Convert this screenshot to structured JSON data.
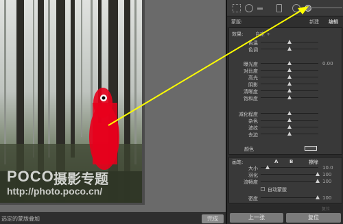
{
  "status_bar": {
    "text": "选定的蒙版叠加",
    "done_label": "完成"
  },
  "watermark": {
    "logo": "POCO",
    "logo_cn": "摄影专题",
    "url": "http://photo.poco.cn/"
  },
  "toolstrip": {
    "icons": [
      "crop-grid-icon",
      "spot-removal-icon",
      "red-eye-icon",
      "graduated-filter-icon",
      "radial-filter-icon",
      "adjustment-brush-icon"
    ]
  },
  "mask": {
    "label": "蒙版:",
    "new_label": "新建",
    "edit_label": "编辑"
  },
  "effects": {
    "label": "效果:",
    "value": "自定 ÷",
    "sliders": [
      {
        "label": "色温",
        "pos": 0.5
      },
      {
        "label": "色调",
        "pos": 0.5
      },
      {
        "label": "曝光度",
        "pos": 0.5,
        "value": "0.00"
      },
      {
        "label": "对比度",
        "pos": 0.5
      },
      {
        "label": "高光",
        "pos": 0.5
      },
      {
        "label": "阴影",
        "pos": 0.5
      },
      {
        "label": "清晰度",
        "pos": 0.5
      },
      {
        "label": "饱和度",
        "pos": 0.5
      },
      {
        "label": "减化程度",
        "pos": 0.5
      },
      {
        "label": "杂色",
        "pos": 0.5
      },
      {
        "label": "波纹",
        "pos": 0.5
      },
      {
        "label": "去边",
        "pos": 0.5
      }
    ],
    "color_label": "颜色"
  },
  "brush": {
    "label": "画笔:",
    "a_label": "A",
    "b_label": "B",
    "erase_label": "擦除",
    "sliders": [
      {
        "label": "大小",
        "pos": 0.12,
        "value": "10.0"
      },
      {
        "label": "羽化",
        "pos": 0.99,
        "value": "100"
      },
      {
        "label": "流畅度",
        "pos": 0.99,
        "value": "100"
      }
    ],
    "auto_mask_label": "自动蒙版",
    "density": {
      "label": "密度",
      "pos": 0.99,
      "value": "100"
    }
  },
  "footer": {
    "reset_small": "复位",
    "prev_label": "上一张",
    "reset_label": "复位"
  },
  "colors": {
    "mask_overlay": "#e8001c",
    "annotation_arrow": "#ffff00",
    "panel_bg": "#2b2b2b"
  }
}
